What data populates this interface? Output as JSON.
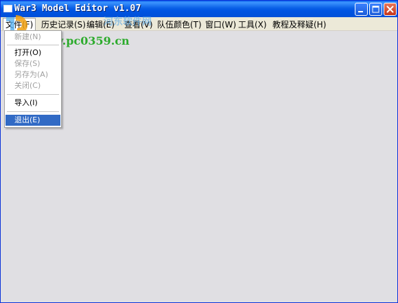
{
  "window": {
    "title": "War3 Model Editor v1.07"
  },
  "menubar": {
    "items": [
      {
        "label": "文件(F)"
      },
      {
        "label": "历史记录(S)"
      },
      {
        "label": "编辑(E)"
      },
      {
        "label": "查看(V)"
      },
      {
        "label": "队伍颜色(T)"
      },
      {
        "label": "窗口(W)"
      },
      {
        "label": "工具(X)"
      },
      {
        "label": "教程及释疑(H)"
      }
    ]
  },
  "file_menu": {
    "items": [
      {
        "label": "新建(N)",
        "enabled": false
      },
      {
        "label": "打开(O)",
        "enabled": true
      },
      {
        "label": "保存(S)",
        "enabled": false
      },
      {
        "label": "另存为(A)",
        "enabled": false
      },
      {
        "label": "关闭(C)",
        "enabled": false
      },
      {
        "label": "导入(I)",
        "enabled": true
      },
      {
        "label": "退出(E)",
        "enabled": true,
        "selected": true
      }
    ]
  },
  "watermark": {
    "site": "www.pc0359.cn",
    "name": "河东软件网"
  },
  "colors": {
    "titlebar": "#0054e3",
    "menu_highlight": "#316ac5",
    "watermark": "#1aa61a",
    "client_bg": "#e0dfe3"
  },
  "icons": {
    "minimize": "minimize-icon",
    "maximize": "maximize-icon",
    "close": "close-icon"
  }
}
